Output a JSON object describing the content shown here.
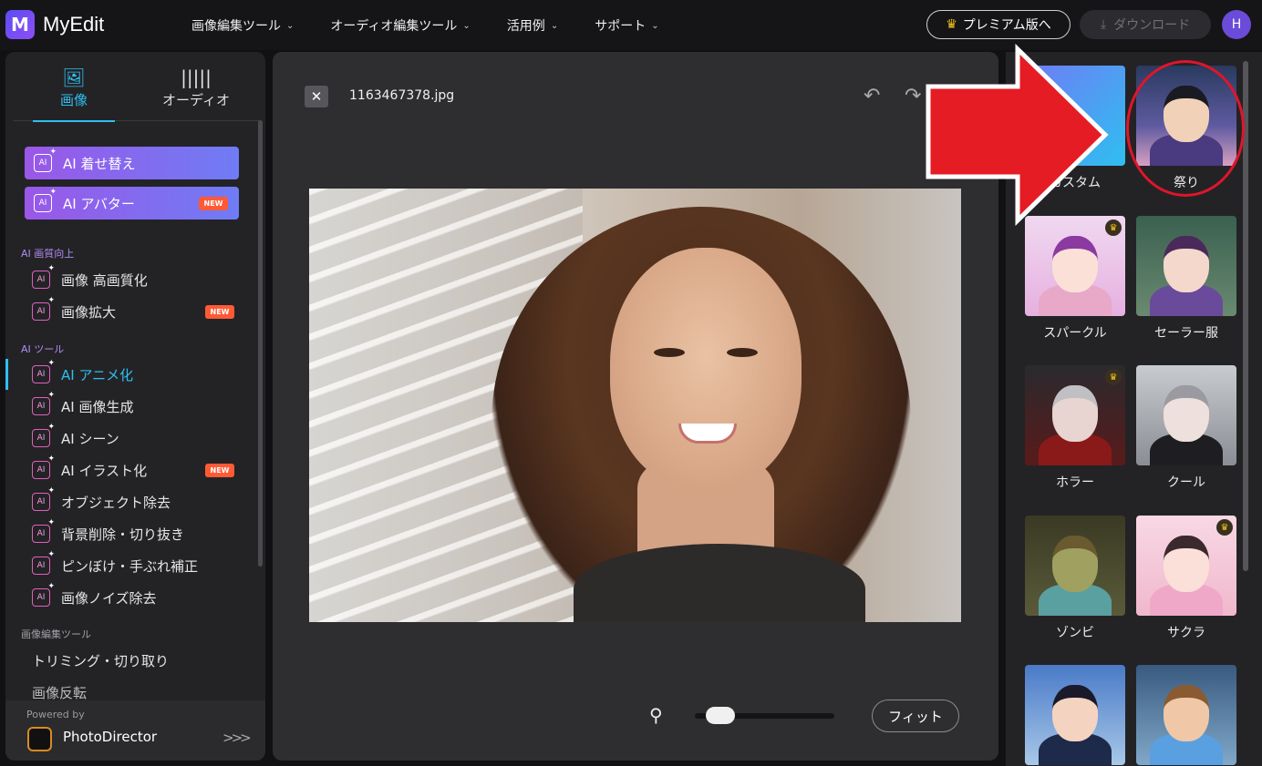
{
  "app": {
    "logo_letter": "M",
    "name": "MyEdit"
  },
  "nav": [
    {
      "label": "画像編集ツール"
    },
    {
      "label": "オーディオ編集ツール"
    },
    {
      "label": "活用例"
    },
    {
      "label": "サポート"
    }
  ],
  "header": {
    "premium_label": "プレミアム版へ",
    "download_label": "ダウンロード",
    "avatar_initial": "H"
  },
  "sidebar": {
    "tabs": [
      {
        "label": "画像"
      },
      {
        "label": "オーディオ"
      }
    ],
    "featured": [
      {
        "label": "AI 着せ替え"
      },
      {
        "label": "AI アバター",
        "badge": "NEW"
      }
    ],
    "sections": [
      {
        "title": "AI 画質向上",
        "items": [
          {
            "label": "画像 高画質化"
          },
          {
            "label": "画像拡大",
            "badge": "NEW"
          }
        ]
      },
      {
        "title": "AI ツール",
        "items": [
          {
            "label": "AI アニメ化"
          },
          {
            "label": "AI 画像生成"
          },
          {
            "label": "AI シーン"
          },
          {
            "label": "AI イラスト化",
            "badge": "NEW"
          },
          {
            "label": "オブジェクト除去"
          },
          {
            "label": "背景削除・切り抜き"
          },
          {
            "label": "ピンぼけ・手ぶれ補正"
          },
          {
            "label": "画像ノイズ除去"
          }
        ]
      },
      {
        "title": "画像編集ツール",
        "items": [
          {
            "label": "トリミング・切り取り"
          },
          {
            "label": "画像反転"
          }
        ]
      }
    ],
    "powered_by": "Powered by",
    "powered_product": "PhotoDirector"
  },
  "editor": {
    "filename": "1163467378.jpg",
    "zoom": {
      "level": 0.1
    },
    "fit_label": "フィット"
  },
  "styles": [
    {
      "label": "カスタム"
    },
    {
      "label": "祭り"
    },
    {
      "label": "スパークル"
    },
    {
      "label": "セーラー服"
    },
    {
      "label": "ホラー"
    },
    {
      "label": "クール"
    },
    {
      "label": "ゾンビ"
    },
    {
      "label": "サクラ"
    }
  ],
  "colors": {
    "accent": "#2fbff0",
    "new_badge": "#ff5a36",
    "annotation_red": "#e0152a",
    "crown": "#f5c518"
  }
}
